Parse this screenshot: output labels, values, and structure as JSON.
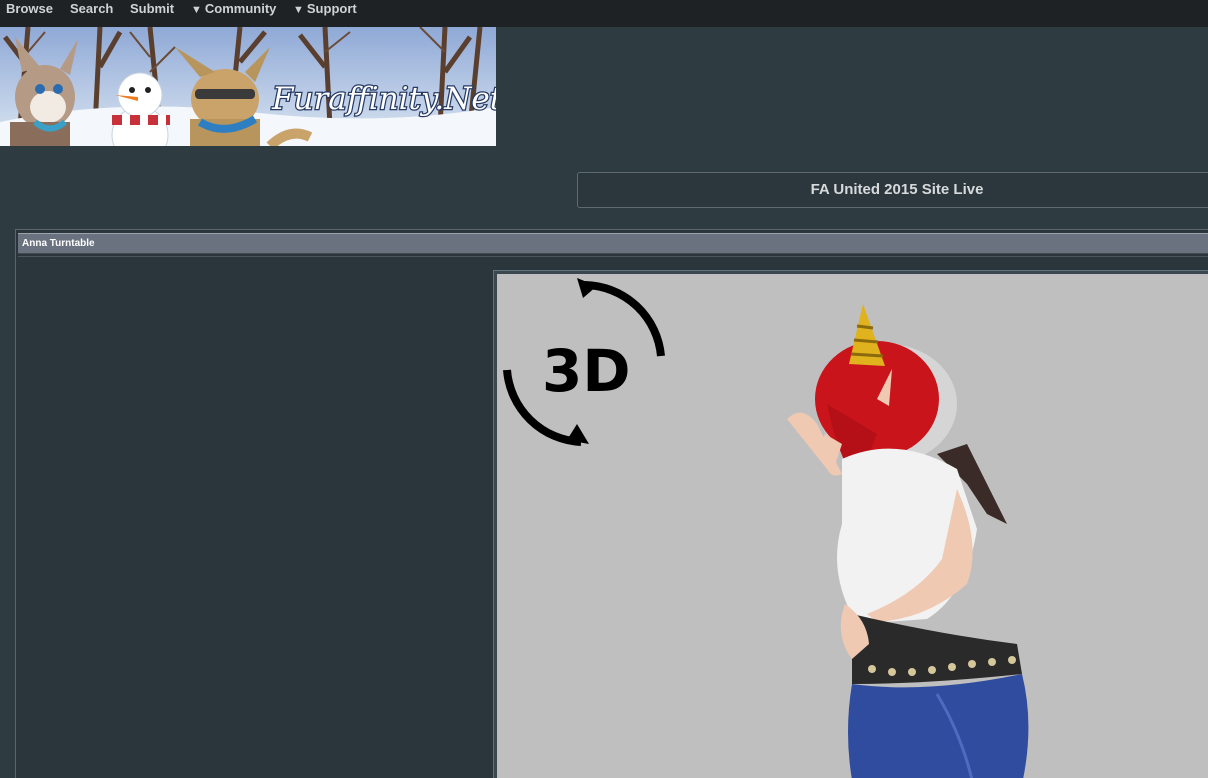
{
  "nav": {
    "browse": "Browse",
    "search": "Search",
    "submit": "Submit",
    "community": "Community",
    "support": "Support",
    "caret_icon": "triangle-down"
  },
  "banner": {
    "logo_text": "Furaffinity.Net"
  },
  "notice": {
    "text": "FA United 2015 Site Live"
  },
  "submission": {
    "title": "Anna Turntable",
    "badge_text": "3D"
  },
  "colors": {
    "page_bg": "#2e3b41",
    "nav_bg": "#1e2225",
    "panel_title_bg": "#6a7280",
    "image_bg": "#bfbfbf"
  }
}
